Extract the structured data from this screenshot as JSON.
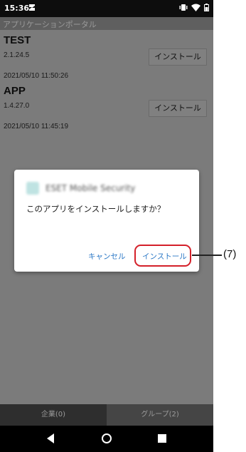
{
  "status_bar": {
    "time": "15:36"
  },
  "app_bar": {
    "title": "アプリケーションポータル"
  },
  "apps": [
    {
      "name": "TEST",
      "version": "2.1.24.5",
      "date": "2021/05/10 11:50:26",
      "install_label": "インストール"
    },
    {
      "name": "APP",
      "version": "1.4.27.0",
      "date": "2021/05/10 11:45:19",
      "install_label": "インストール"
    }
  ],
  "tabs": [
    {
      "label": "企業(0)",
      "selected": true
    },
    {
      "label": "グループ(2)",
      "selected": false
    }
  ],
  "dialog": {
    "app_name": "ESET Mobile Security",
    "message": "このアプリをインストールしますか？",
    "cancel_label": "キャンセル",
    "install_label": "インストール"
  },
  "annotation": {
    "label": "(7)"
  },
  "colors": {
    "accent_link": "#2b78c6",
    "highlight": "#d4202a",
    "overlay_bg": "#7b7b7b"
  }
}
